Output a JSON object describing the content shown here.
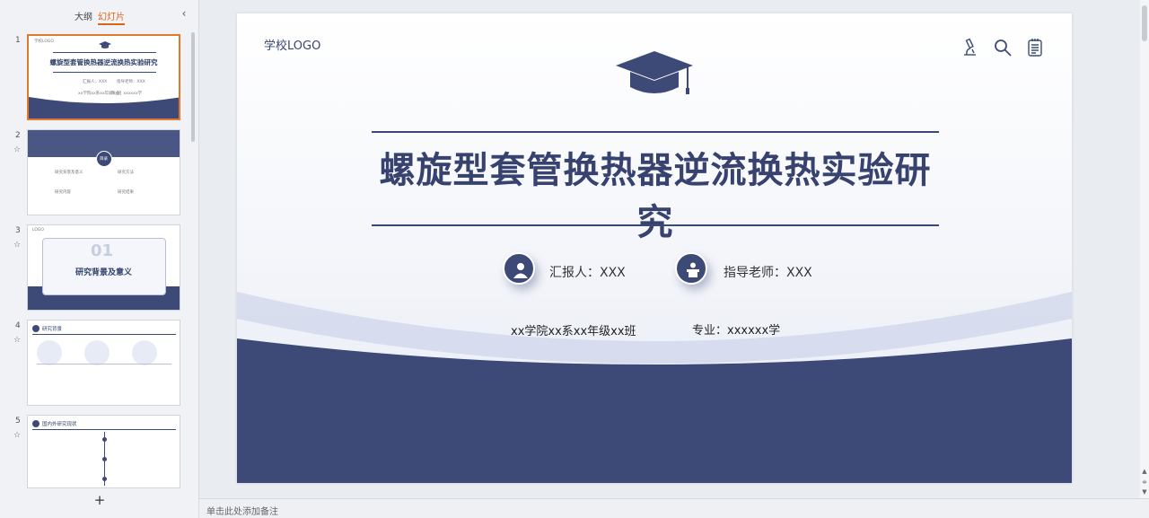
{
  "panel": {
    "tab_outline": "大纲",
    "tab_slides": "幻灯片",
    "collapse": "‹",
    "add_slide": "+"
  },
  "thumbnails": [
    {
      "number": "1",
      "title": "螺旋型套管换热器逆流换热实验研究",
      "logo": "学校LOGO",
      "reporter": "汇报人：XXX",
      "advisor": "指导老师：XXX",
      "class": "xx学院xx系xx年级xx班",
      "major": "专业：xxxxxx学"
    },
    {
      "number": "2",
      "center": "目录",
      "items": [
        "研究背景及意义",
        "研究方法",
        "研究内容",
        "研究结果"
      ]
    },
    {
      "number": "3",
      "logo": "LOGO",
      "big_number": "01",
      "heading": "研究背景及意义"
    },
    {
      "number": "4",
      "heading": "研究背景"
    },
    {
      "number": "5",
      "heading": "国内外研究现状"
    }
  ],
  "slide": {
    "logo_text": "学校LOGO",
    "title": "螺旋型套管换热器逆流换热实验研究",
    "reporter": "汇报人：XXX",
    "advisor": "指导老师：XXX",
    "class_info": "xx学院xx系xx年级xx班",
    "major_info": "专业：xxxxxx学",
    "colors": {
      "primary": "#3d4a77",
      "accent": "#e0782f"
    }
  },
  "notes": {
    "placeholder": "单击此处添加备注"
  }
}
